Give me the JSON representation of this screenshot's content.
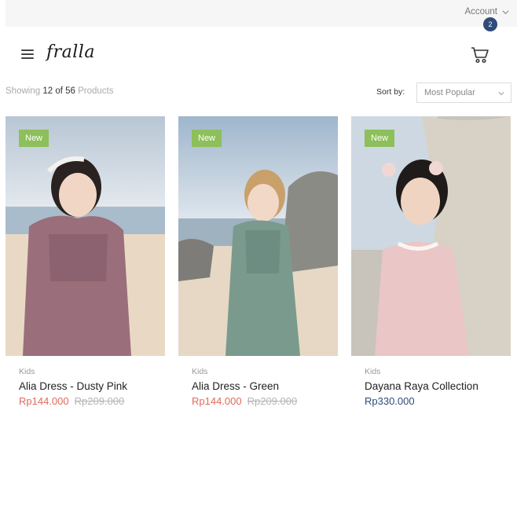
{
  "topbar": {
    "account_label": "Account"
  },
  "header": {
    "logo_text": "fralla",
    "cart_count": "2"
  },
  "toolbar": {
    "showing_prefix": "Showing",
    "showing_count": "12 of 56",
    "showing_suffix": "Products",
    "sort_label": "Sort by:",
    "sort_value": "Most Popular"
  },
  "products": [
    {
      "badge": "New",
      "category": "Kids",
      "name": "Alia Dress - Dusty Pink",
      "price": "Rp144.000",
      "old_price": "Rp209.000"
    },
    {
      "badge": "New",
      "category": "Kids",
      "name": "Alia Dress - Green",
      "price": "Rp144.000",
      "old_price": "Rp209.000"
    },
    {
      "badge": "New",
      "category": "Kids",
      "name": "Dayana Raya Collection",
      "price": "Rp330.000"
    }
  ],
  "colors": {
    "accent": "#2e4b7a",
    "sale": "#e26a5a",
    "badge": "#8dbf5a"
  }
}
